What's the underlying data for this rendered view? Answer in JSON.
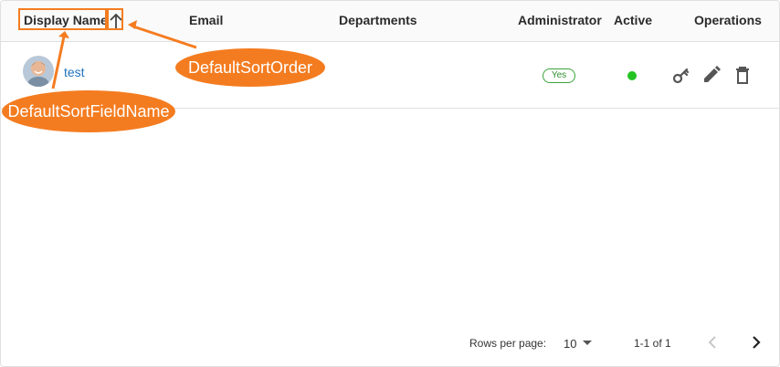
{
  "table": {
    "columns": {
      "display_name": "Display Name",
      "email": "Email",
      "departments": "Departments",
      "administrator": "Administrator",
      "active": "Active",
      "operations": "Operations"
    },
    "sort": {
      "field": "Display Name",
      "order": "ascending",
      "icon": "arrow-up-icon"
    },
    "rows": [
      {
        "display_name": "test",
        "email": "",
        "departments": "",
        "administrator": "Yes",
        "active": true,
        "operations": [
          "key-icon",
          "edit-pencil-icon",
          "delete-trash-icon"
        ]
      }
    ]
  },
  "pagination": {
    "rows_per_page_label": "Rows per page:",
    "rows_per_page_value": "10",
    "range": "1-1 of 1"
  },
  "annotations": {
    "sort_field_label": "DefaultSortFieldName",
    "sort_order_label": "DefaultSortOrder"
  },
  "colors": {
    "accent": "#f47c20",
    "link": "#1e73be",
    "active_dot": "#22c322",
    "yes_badge": "#3aa33a"
  }
}
